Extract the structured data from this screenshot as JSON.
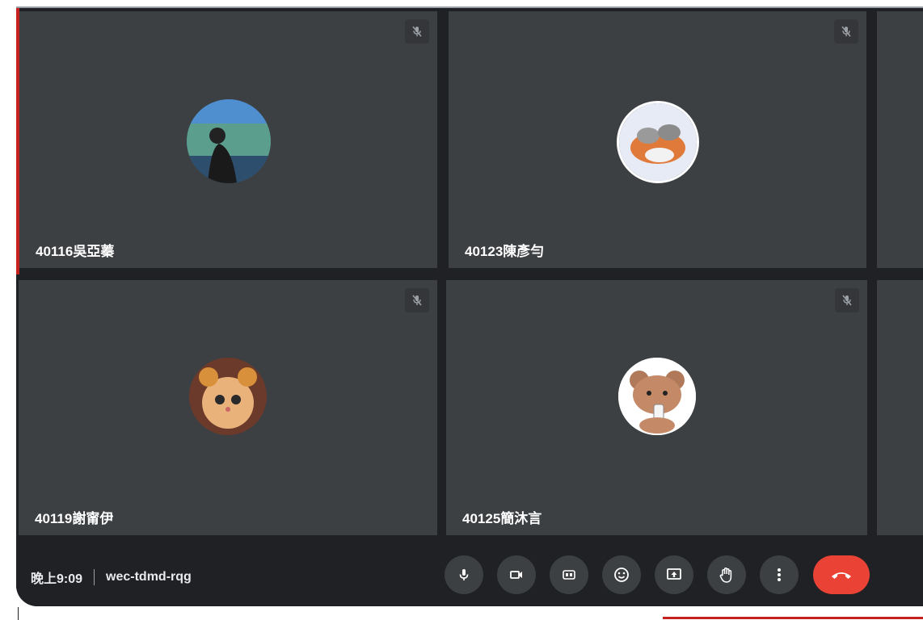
{
  "participants": [
    {
      "name": "40116吳亞蓁",
      "muted": true
    },
    {
      "name": "40123陳彥勻",
      "muted": true
    },
    {
      "name": "40119謝甯伊",
      "muted": true
    },
    {
      "name": "40125簡沐言",
      "muted": true
    }
  ],
  "bottom_bar": {
    "time": "晚上9:09",
    "meeting_code": "wec-tdmd-rqg",
    "controls": [
      "microphone-icon",
      "camera-icon",
      "captions-icon",
      "emoji-icon",
      "present-icon",
      "raise-hand-icon",
      "more-options-icon",
      "end-call-icon"
    ]
  },
  "colors": {
    "background": "#202124",
    "tile": "#3c4043",
    "end_call": "#ea4335"
  }
}
